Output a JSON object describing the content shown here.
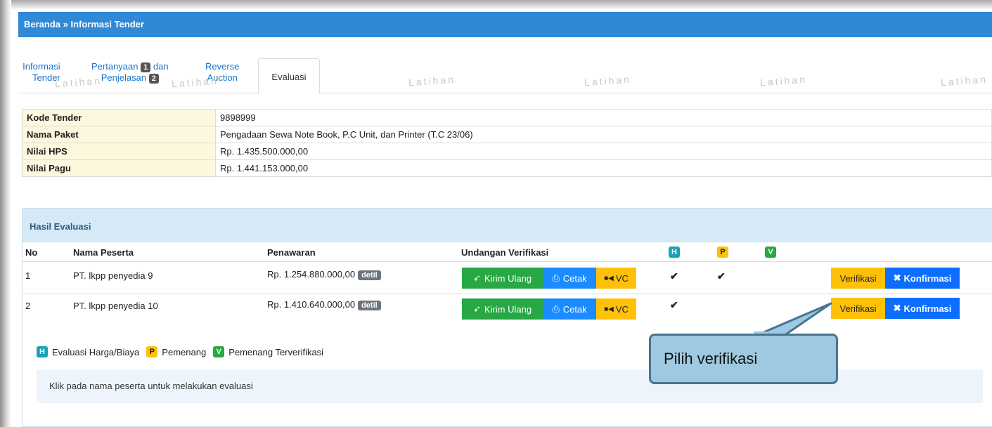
{
  "breadcrumb": "Beranda » Informasi Tender",
  "tabs": {
    "informasi_l1": "Informasi",
    "informasi_l2": "Tender",
    "pertanyaan_l1": "Pertanyaan",
    "pertanyaan_badge": "1",
    "pertanyaan_dan": "dan",
    "pertanyaan_l2": "Penjelasan",
    "pertanyaan_badge2": "2",
    "reverse_l1": "Reverse",
    "reverse_l2": "Auction",
    "evaluasi": "Evaluasi"
  },
  "watermark": "Latihan",
  "info": {
    "kode_label": "Kode Tender",
    "kode_value": "9898999",
    "paket_label": "Nama Paket",
    "paket_value": "Pengadaan Sewa Note Book, P.C Unit, dan Printer (T.C 23/06)",
    "hps_label": "Nilai HPS",
    "hps_value": "Rp. 1.435.500.000,00",
    "pagu_label": "Nilai Pagu",
    "pagu_value": "Rp. 1.441.153.000,00"
  },
  "panel_title": "Hasil Evaluasi",
  "columns": {
    "no": "No",
    "nama": "Nama Peserta",
    "penawaran": "Penawaran",
    "undangan": "Undangan Verifikasi",
    "h": "H",
    "p": "P",
    "v": "V"
  },
  "rows": [
    {
      "no": "1",
      "nama": "PT. lkpp penyedia 9",
      "penawaran": "Rp. 1.254.880.000,00",
      "h": true,
      "p": true,
      "v": false
    },
    {
      "no": "2",
      "nama": "PT. lkpp penyedia 10",
      "penawaran": "Rp. 1.410.640.000,00",
      "h": true,
      "p": false,
      "v": false
    }
  ],
  "buttons": {
    "detil": "detil",
    "kirim_ulang": "Kirim Ulang",
    "cetak": "Cetak",
    "vc": "VC",
    "verifikasi": "Verifikasi",
    "konfirmasi": "Konfirmasi"
  },
  "check_mark": "✔",
  "legend": {
    "h_text": "Evaluasi Harga/Biaya",
    "p_text": "Pemenang",
    "v_text": "Pemenang Terverifikasi"
  },
  "note": "Klik pada nama peserta untuk melakukan evaluasi",
  "callout": "Pilih verifikasi",
  "colors": {
    "header_blue": "#2f89d6",
    "green": "#27a844",
    "blue": "#1a8cff",
    "yellow": "#ffc107"
  }
}
